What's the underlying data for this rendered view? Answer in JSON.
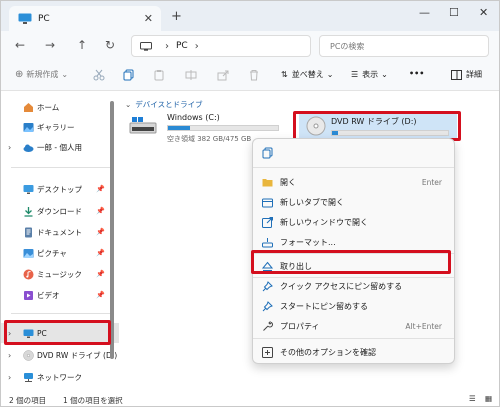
{
  "tab": {
    "title": "PC",
    "close": "✕",
    "new": "+"
  },
  "window": {
    "minimize": "—",
    "maximize": "☐",
    "close": "✕"
  },
  "nav": {
    "back": "←",
    "forward": "→",
    "up": "↑",
    "refresh": "↻"
  },
  "address": {
    "location": "PC",
    "sep1": "›",
    "sep2": "›",
    "search_placeholder": "PCの検索"
  },
  "toolbar": {
    "new": "新規作成",
    "sort": "並べ替え",
    "view": "表示",
    "more": "•••",
    "details": "詳細"
  },
  "sidebar": {
    "home": "ホーム",
    "gallery": "ギャラリー",
    "onedrive": "一郎 - 個人用",
    "desktop": "デスクトップ",
    "downloads": "ダウンロード",
    "documents": "ドキュメント",
    "pictures": "ピクチャ",
    "music": "ミュージック",
    "videos": "ビデオ",
    "pc": "PC",
    "dvd": "DVD RW ドライブ (D:)",
    "network": "ネットワーク"
  },
  "main": {
    "group": "デバイスとドライブ",
    "drive_c": {
      "name": "Windows (C:)",
      "info": "空き領域 382 GB/475 GB",
      "used_fraction": 0.2
    },
    "drive_d": {
      "name": "DVD RW ドライブ (D:)",
      "used_fraction": 0.05
    }
  },
  "menu": {
    "open": "開く",
    "open_sc": "Enter",
    "open_tab": "新しいタブで開く",
    "open_window": "新しいウィンドウで開く",
    "format": "フォーマット...",
    "eject": "取り出し",
    "pin_quick": "クイック アクセスにピン留めする",
    "pin_start": "スタートにピン留めする",
    "properties": "プロパティ",
    "properties_sc": "Alt+Enter",
    "more_options": "その他のオプションを確認"
  },
  "status": {
    "count": "2 個の項目",
    "selected": "1 個の項目を選択"
  },
  "colors": {
    "accent": "#2a8ad4",
    "highlight": "#d40f1e"
  }
}
